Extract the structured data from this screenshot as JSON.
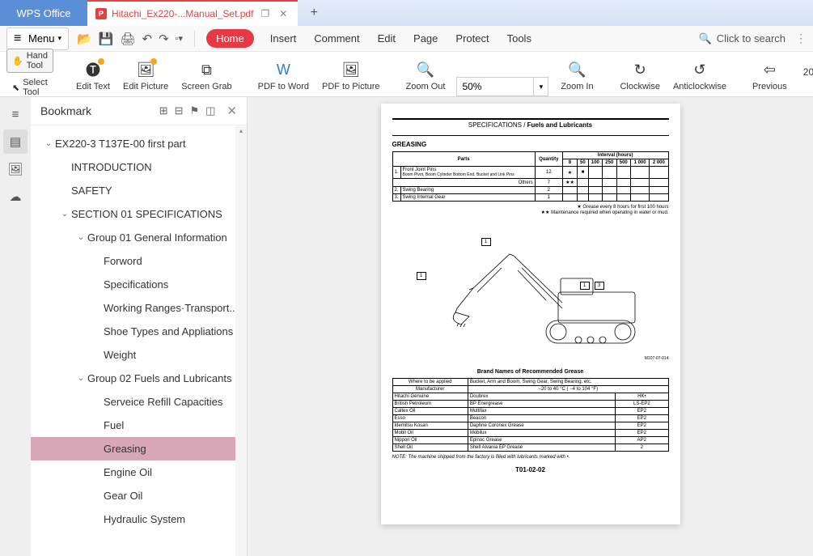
{
  "app_name": "WPS Office",
  "tab": {
    "title": "Hitachi_Ex220-...Manual_Set.pdf"
  },
  "menu_button": "Menu",
  "menus": [
    "Home",
    "Insert",
    "Comment",
    "Edit",
    "Page",
    "Protect",
    "Tools"
  ],
  "active_menu": "Home",
  "search_label": "Click to search",
  "tools_left": {
    "hand": "Hand Tool",
    "select": "Select Tool"
  },
  "toolbar": {
    "edit_text": "Edit Text",
    "edit_picture": "Edit Picture",
    "screen_grab": "Screen Grab",
    "pdf_to_word": "PDF to Word",
    "pdf_to_picture": "PDF to Picture",
    "zoom_out": "Zoom Out",
    "zoom_value": "50%",
    "zoom_in": "Zoom In",
    "clockwise": "Clockwise",
    "anticlockwise": "Anticlockwise",
    "previous": "Previous",
    "page_indicator": "20"
  },
  "sidebar": {
    "title": "Bookmark",
    "items": [
      {
        "label": "EX220-3 T137E-00 first part",
        "level": 0,
        "chev": "down"
      },
      {
        "label": "INTRODUCTION",
        "level": 1
      },
      {
        "label": "SAFETY",
        "level": 1
      },
      {
        "label": "SECTION 01 SPECIFICATIONS",
        "level": 1,
        "chev": "down"
      },
      {
        "label": "Group 01 General Information",
        "level": 2,
        "chev": "down"
      },
      {
        "label": "Forword",
        "level": 3
      },
      {
        "label": "Specifications",
        "level": 3
      },
      {
        "label": "Working Ranges·Transport...",
        "level": 3
      },
      {
        "label": "Shoe Types and Appliations",
        "level": 3
      },
      {
        "label": "Weight",
        "level": 3
      },
      {
        "label": "Group 02 Fuels and Lubricants",
        "level": 2,
        "chev": "down"
      },
      {
        "label": "Serveice Refill Capacities",
        "level": 3
      },
      {
        "label": "Fuel",
        "level": 3
      },
      {
        "label": "Greasing",
        "level": 3,
        "selected": true
      },
      {
        "label": "Engine Oil",
        "level": 3
      },
      {
        "label": "Gear Oil",
        "level": 3
      },
      {
        "label": "Hydraulic System",
        "level": 3
      }
    ]
  },
  "doc": {
    "header_prefix": "SPECIFICATIONS / ",
    "header_bold": "Fuels and Lubricants",
    "greasing": "GREASING",
    "table_headers": {
      "parts": "Parts",
      "quantity": "Quantity",
      "interval": "Interval (hours)",
      "cols": [
        "8",
        "50",
        "100",
        "250",
        "500",
        "1 000",
        "2 000"
      ]
    },
    "rows": [
      {
        "n": "1.",
        "part": "Front Joint Pins",
        "sub": "Boom Pivot, Boom Cylinder Bottom End, Bucket and Link Pins",
        "qty": "12",
        "mark8": "★",
        "mark50": "■"
      },
      {
        "sub2": "Others",
        "qty": "7",
        "mark8": "★★"
      },
      {
        "n": "2.",
        "part": "Swing Bearing",
        "qty": "2"
      },
      {
        "n": "3.",
        "part": "Swing Internal Gear",
        "qty": "1"
      }
    ],
    "note_star": "★ Grease every 8 hours for first 100 hours",
    "note_dbl": "★★ Maintenance required when operating in water or mud.",
    "brands_title": "Brand Names of Recommended Grease",
    "brands_where": "Where to be applied",
    "brands_where_val": "Bucket, Arm and Boom, Swing Gear, Swing Bearing, etc.",
    "brands_mfr": "Manufacturer",
    "brands_temp": "−20 to 40 °C ( −4 to 104 °F)",
    "brands": [
      [
        "Hitachi Genuine",
        "Doubrex",
        "HK•"
      ],
      [
        "British Petroleum",
        "BP Energrease",
        "LS-EP2"
      ],
      [
        "Caltex Oil",
        "Multifax",
        "EP2"
      ],
      [
        "Esso",
        "Beacon",
        "EP2"
      ],
      [
        "Idemitsu Kosan",
        "Daphne Coronex Grease",
        "EP2"
      ],
      [
        "Mobil Oil",
        "Mobilux",
        "EP2"
      ],
      [
        "Nippon Oil",
        "Epinoc Grease",
        "AP2"
      ],
      [
        "Shell Oil",
        "Shell Alvania EP Grease",
        "2"
      ]
    ],
    "footnote": "NOTE: The machine shipped from the factory is filled with lubricants marked with •.",
    "page_no": "T01-02-02",
    "diagram_ref": "M107-07-014"
  }
}
